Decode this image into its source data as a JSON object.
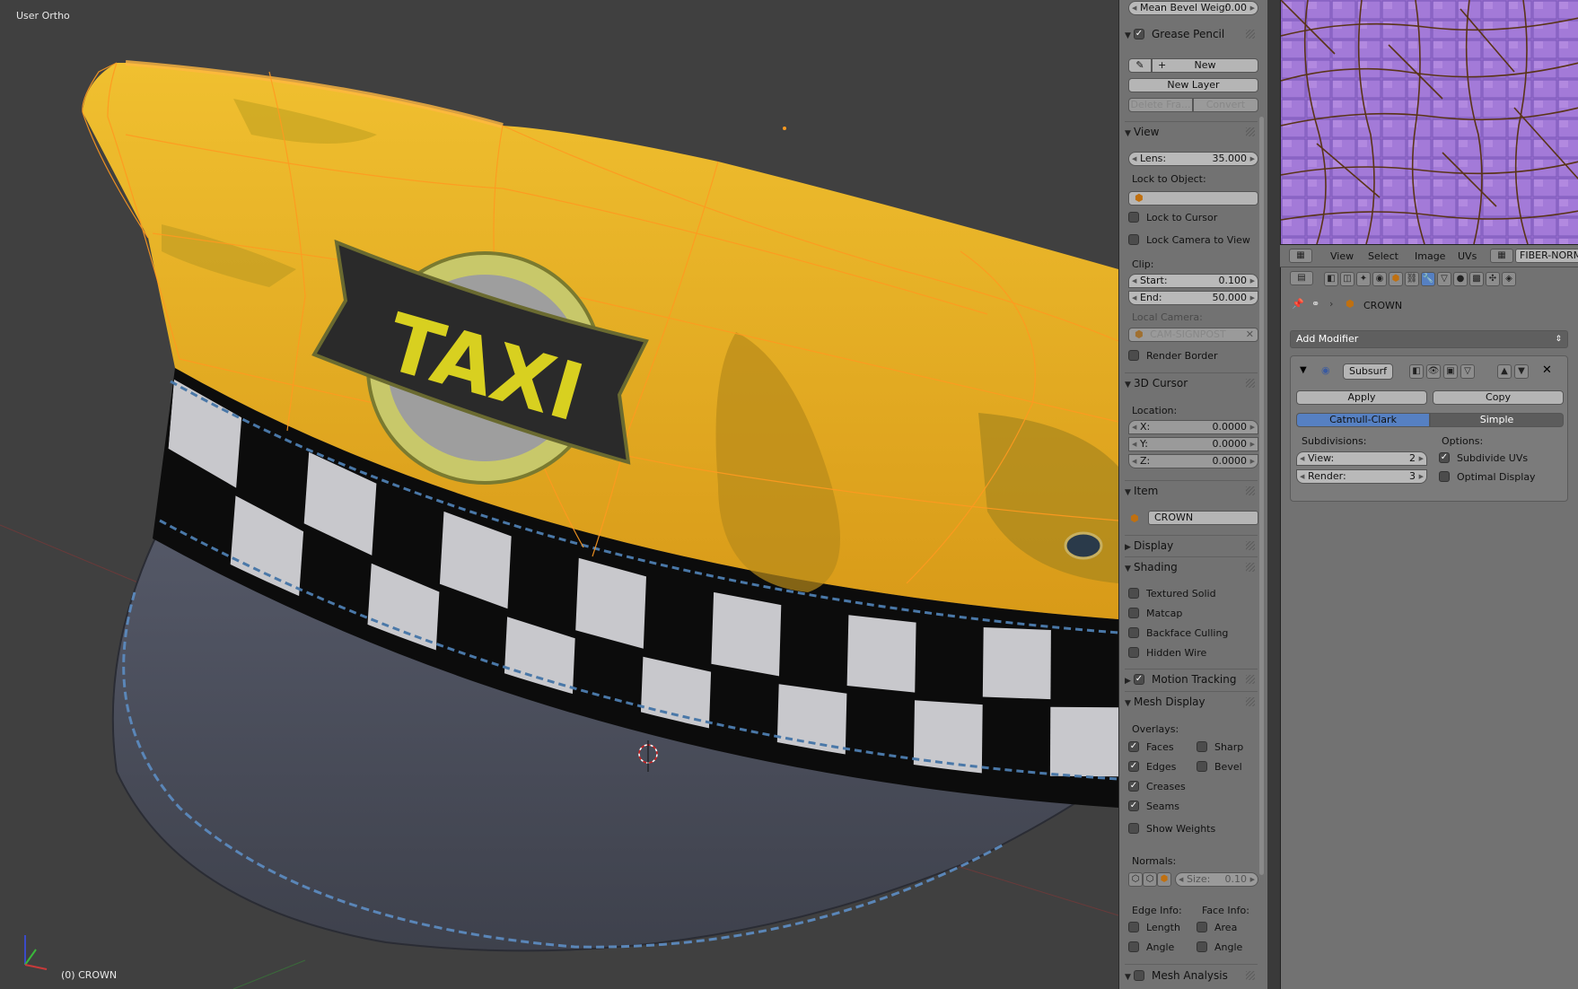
{
  "viewport": {
    "view_name": "User Ortho",
    "object_status": "(0) CROWN",
    "model_label": "TAXI"
  },
  "panel": {
    "mean_bevel": {
      "label": "Mean Bevel Weig:",
      "value": "0.00"
    },
    "grease_pencil": {
      "title": "Grease Pencil",
      "enabled": true,
      "new": "New",
      "new_layer": "New Layer",
      "delete_frame": "Delete Fra...",
      "convert": "Convert"
    },
    "view": {
      "title": "View",
      "lens": {
        "label": "Lens:",
        "value": "35.000"
      },
      "lock_to_object": "Lock to Object:",
      "lock_to_cursor": "Lock to Cursor",
      "lock_camera_to_view": "Lock Camera to View",
      "clip": "Clip:",
      "start": {
        "label": "Start:",
        "value": "0.100"
      },
      "end": {
        "label": "End:",
        "value": "50.000"
      },
      "local_camera": "Local Camera:",
      "camera_name": "CAM-SIGNPOST",
      "render_border": "Render Border"
    },
    "cursor": {
      "title": "3D Cursor",
      "location": "Location:",
      "x": {
        "label": "X:",
        "value": "0.0000"
      },
      "y": {
        "label": "Y:",
        "value": "0.0000"
      },
      "z": {
        "label": "Z:",
        "value": "0.0000"
      }
    },
    "item": {
      "title": "Item",
      "name": "CROWN"
    },
    "display": {
      "title": "Display"
    },
    "shading": {
      "title": "Shading",
      "options": [
        {
          "label": "Textured Solid",
          "checked": false
        },
        {
          "label": "Matcap",
          "checked": false
        },
        {
          "label": "Backface Culling",
          "checked": false
        },
        {
          "label": "Hidden Wire",
          "checked": false
        }
      ]
    },
    "motion_tracking": {
      "title": "Motion Tracking",
      "enabled": true
    },
    "mesh_display": {
      "title": "Mesh Display",
      "overlays": "Overlays:",
      "faces": "Faces",
      "sharp": "Sharp",
      "edges": "Edges",
      "bevel": "Bevel",
      "creases": "Creases",
      "seams": "Seams",
      "show_weights": "Show Weights",
      "normals": "Normals:",
      "size": {
        "label": "Size:",
        "value": "0.10"
      },
      "edge_info": "Edge Info:",
      "face_info": "Face Info:",
      "length": "Length",
      "area": "Area",
      "angle_edge": "Angle",
      "angle_face": "Angle"
    },
    "mesh_analysis": {
      "title": "Mesh Analysis",
      "enabled": false
    }
  },
  "uv_header": {
    "menus": [
      "View",
      "Select",
      "Image",
      "UVs"
    ],
    "image_name": "FIBER-NORM"
  },
  "properties": {
    "breadcrumb_object": "CROWN",
    "add_modifier": "Add Modifier",
    "modifier": {
      "name": "Subsurf",
      "apply": "Apply",
      "copy": "Copy",
      "catmull_clark": "Catmull-Clark",
      "simple": "Simple",
      "subdivisions": "Subdivisions:",
      "options": "Options:",
      "view": {
        "label": "View:",
        "value": "2"
      },
      "render": {
        "label": "Render:",
        "value": "3"
      },
      "subdivide_uvs": "Subdivide UVs",
      "optimal_display": "Optimal Display"
    }
  },
  "colors": {
    "selection_orange": "#ff9a20",
    "hat_yellow": "#e8a820",
    "active_blue": "#5680c2",
    "uv_purple": "#9068c8"
  }
}
